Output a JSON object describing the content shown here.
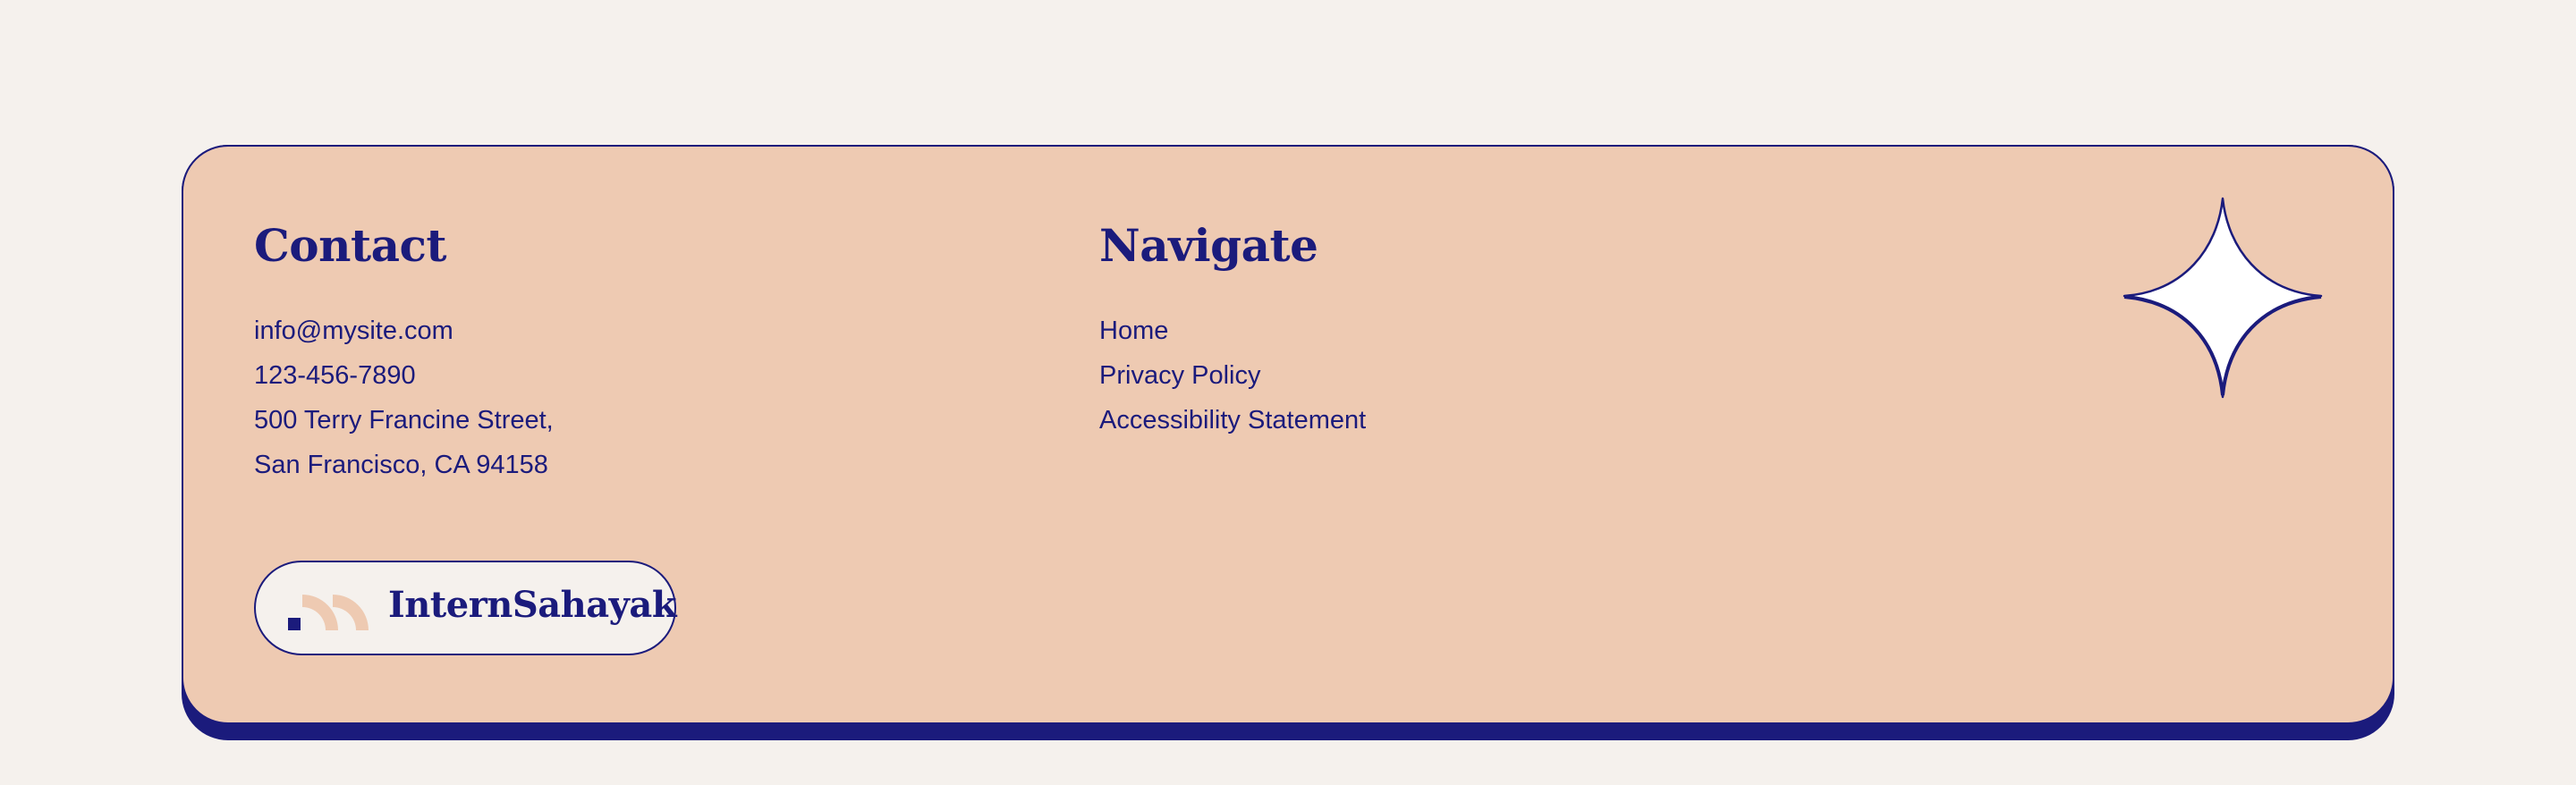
{
  "colors": {
    "page_background": "#f5f1ed",
    "card_background": "#eecab2",
    "accent_navy": "#1b1b7c"
  },
  "contact": {
    "title": "Contact",
    "email": "info@mysite.com",
    "phone": "123-456-7890",
    "address_line1": "500 Terry Francine Street,",
    "address_line2": "San Francisco, CA 94158"
  },
  "navigate": {
    "title": "Navigate",
    "links": [
      {
        "label": "Home"
      },
      {
        "label": "Privacy Policy"
      },
      {
        "label": "Accessibility Statement"
      }
    ]
  },
  "logo": {
    "text": "InternSahayak",
    "icon": "arc-signal-logo-icon"
  },
  "decoration": {
    "icon": "four-point-sparkle-icon"
  }
}
